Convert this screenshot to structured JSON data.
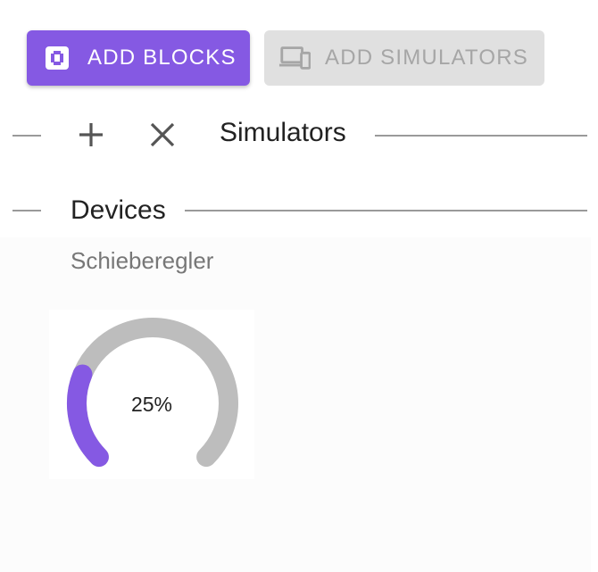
{
  "toolbar": {
    "add_blocks_label": "ADD BLOCKS",
    "add_simulators_label": "ADD SIMULATORS",
    "primary_color": "#8559e3",
    "disabled_color": "#e0e0e0"
  },
  "simulators_section": {
    "title": "Simulators",
    "add_icon": "plus-icon",
    "remove_icon": "close-icon"
  },
  "devices_section": {
    "title": "Devices",
    "device": {
      "label": "Schieberegler",
      "value_text": "25%",
      "value": 0.25,
      "fill_color": "#8559e3",
      "track_color": "#bdbdbd"
    }
  }
}
